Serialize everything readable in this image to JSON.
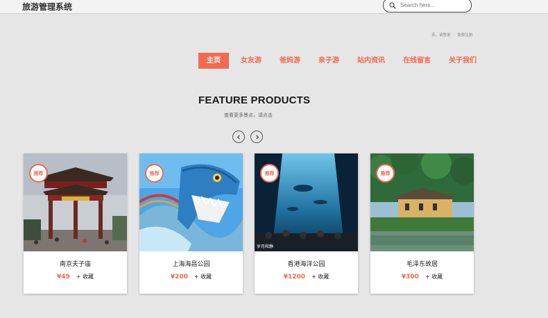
{
  "header": {
    "brand": "旅游管理系统",
    "search_placeholder": "Search here..."
  },
  "login_links": [
    "亲，请登录",
    "免费注册"
  ],
  "nav": [
    {
      "label": "主页",
      "active": true
    },
    {
      "label": "女友游",
      "active": false
    },
    {
      "label": "爸妈游",
      "active": false
    },
    {
      "label": "亲子游",
      "active": false
    },
    {
      "label": "站内资讯",
      "active": false
    },
    {
      "label": "在线留言",
      "active": false
    },
    {
      "label": "关于我们",
      "active": false
    }
  ],
  "section": {
    "title": "FEATURE PRODUCTS",
    "subtitle": "查看更多景点，请点击"
  },
  "products": [
    {
      "badge": "推荐",
      "name": "南京夫子庙",
      "price": "¥49",
      "fav": "+ 收藏"
    },
    {
      "badge": "推荐",
      "name": "上海海昌公园",
      "price": "¥200",
      "fav": "+ 收藏"
    },
    {
      "badge": "推荐",
      "name": "香港海洋公园",
      "price": "¥1200",
      "fav": "+ 收藏",
      "photo_caption": "岁月和静"
    },
    {
      "badge": "推荐",
      "name": "毛泽东故居",
      "price": "¥300",
      "fav": "+ 收藏"
    }
  ],
  "colors": {
    "accent": "#ef6a4e",
    "background": "#e6e6e6"
  }
}
